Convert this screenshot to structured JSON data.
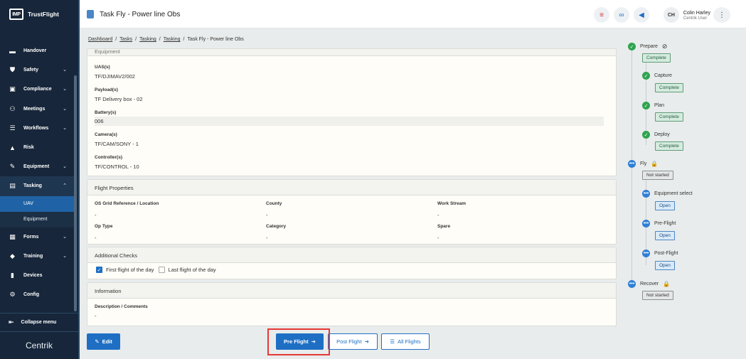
{
  "app": {
    "brand_badge": "IMP",
    "brand_name": "TrustFlight",
    "footer_logo": "Centrik"
  },
  "sidebar": {
    "items": [
      {
        "label": "Handover",
        "icon": "handover-icon",
        "chevron": false
      },
      {
        "label": "Safety",
        "icon": "shield-icon",
        "chevron": true
      },
      {
        "label": "Compliance",
        "icon": "compliance-icon",
        "chevron": true
      },
      {
        "label": "Meetings",
        "icon": "meetings-icon",
        "chevron": true
      },
      {
        "label": "Workflows",
        "icon": "workflows-icon",
        "chevron": true
      },
      {
        "label": "Risk",
        "icon": "warning-icon",
        "chevron": false
      },
      {
        "label": "Equipment",
        "icon": "wrench-icon",
        "chevron": true
      },
      {
        "label": "Tasking",
        "icon": "clipboard-icon",
        "chevron": true,
        "expanded": true
      }
    ],
    "tasking_sub": [
      {
        "label": "UAV",
        "selected": true
      },
      {
        "label": "Equipment",
        "selected": false
      }
    ],
    "items_after": [
      {
        "label": "Forms",
        "icon": "forms-icon",
        "chevron": true
      },
      {
        "label": "Training",
        "icon": "graduation-icon",
        "chevron": true
      },
      {
        "label": "Devices",
        "icon": "devices-icon",
        "chevron": false
      },
      {
        "label": "Config",
        "icon": "config-icon",
        "chevron": false
      }
    ],
    "collapse_label": "Collapse menu"
  },
  "header": {
    "title": "Task Fly - Power line Obs",
    "user_initials": "CH",
    "user_name": "Colin Harley",
    "user_role": "Centrik User"
  },
  "breadcrumb": [
    {
      "label": "Dashboard",
      "link": true
    },
    {
      "label": "Tasks",
      "link": true
    },
    {
      "label": "Tasking",
      "link": true
    },
    {
      "label": "Tasking",
      "link": true
    },
    {
      "label": "Task Fly - Power line Obs",
      "link": false
    }
  ],
  "equipment": {
    "heading": "Equipment",
    "fields": [
      {
        "label": "UAS(s)",
        "value": "TF/DJIMAV2/002"
      },
      {
        "label": "Payload(s)",
        "value": "TF Delivery box - 02"
      },
      {
        "label": "Battery(s)",
        "value": "006"
      },
      {
        "label": "Camera(s)",
        "value": "TF/CAM/SONY - 1"
      },
      {
        "label": "Controller(s)",
        "value": "TF/CONTROL - 10"
      }
    ]
  },
  "flight_properties": {
    "heading": "Flight Properties",
    "fields": [
      {
        "label": "OS Grid Reference / Location",
        "value": "-"
      },
      {
        "label": "County",
        "value": "-"
      },
      {
        "label": "Work Stream",
        "value": "-"
      },
      {
        "label": "Op Type",
        "value": "-"
      },
      {
        "label": "Category",
        "value": "-"
      },
      {
        "label": "Spare",
        "value": "-"
      }
    ]
  },
  "additional_checks": {
    "heading": "Additional Checks",
    "first_flight_label": "First flight of the day",
    "first_flight_checked": true,
    "last_flight_label": "Last flight of the day",
    "last_flight_checked": false
  },
  "information": {
    "heading": "Information",
    "label": "Description / Comments",
    "value": "-"
  },
  "actions": {
    "edit": "Edit",
    "pre_flight": "Pre Flight",
    "post_flight": "Post Flight",
    "all_flights": "All Flights"
  },
  "timeline": {
    "prepare": {
      "label": "Prepare",
      "status": "Complete"
    },
    "capture": {
      "label": "Capture",
      "status": "Complete"
    },
    "plan": {
      "label": "Plan",
      "status": "Complete"
    },
    "deploy": {
      "label": "Deploy",
      "status": "Complete"
    },
    "fly": {
      "label": "Fly",
      "status": "Not started"
    },
    "equipment_select": {
      "label": "Equipment select",
      "status": "Open"
    },
    "pre_flight": {
      "label": "Pre-Flight",
      "status": "Open"
    },
    "post_flight": {
      "label": "Post-Flight",
      "status": "Open"
    },
    "recover": {
      "label": "Recover",
      "status": "Not started"
    }
  },
  "colors": {
    "sidebar_bg": "#17263a",
    "primary": "#1e6fc4",
    "complete_green": "#2ea44f",
    "highlight_red": "#e53935"
  }
}
